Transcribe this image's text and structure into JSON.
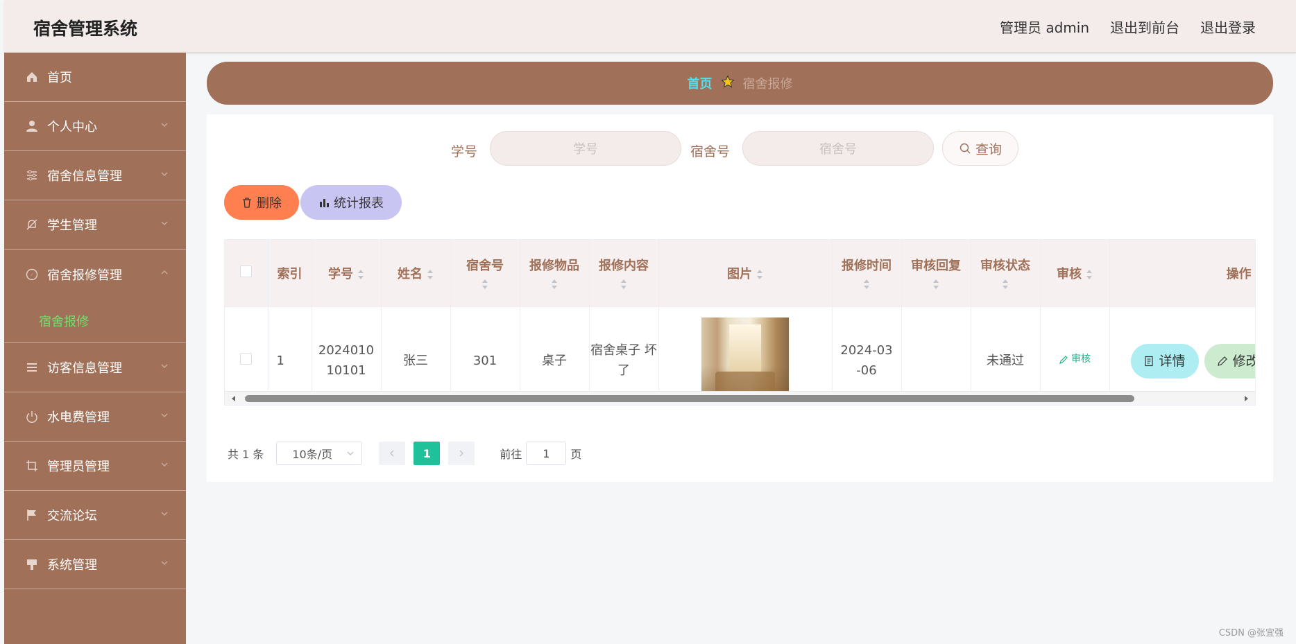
{
  "header": {
    "title": "宿舍管理系统",
    "admin_label": "管理员 admin",
    "front_label": "退出到前台",
    "logout_label": "退出登录"
  },
  "sidebar": {
    "items": [
      {
        "label": "首页",
        "icon": "home-icon"
      },
      {
        "label": "个人中心",
        "icon": "user-icon"
      },
      {
        "label": "宿舍信息管理",
        "icon": "sliders-icon"
      },
      {
        "label": "学生管理",
        "icon": "bell-off-icon"
      },
      {
        "label": "宿舍报修管理",
        "icon": "compass-icon",
        "open": true,
        "sub": [
          "宿舍报修"
        ]
      },
      {
        "label": "访客信息管理",
        "icon": "menu-icon"
      },
      {
        "label": "水电费管理",
        "icon": "power-icon"
      },
      {
        "label": "管理员管理",
        "icon": "crop-icon"
      },
      {
        "label": "交流论坛",
        "icon": "flag-icon"
      },
      {
        "label": "系统管理",
        "icon": "brush-icon"
      }
    ]
  },
  "breadcrumb": {
    "home": "首页",
    "current": "宿舍报修"
  },
  "search": {
    "student_no_label": "学号",
    "student_no_placeholder": "学号",
    "dorm_no_label": "宿舍号",
    "dorm_no_placeholder": "宿舍号",
    "query_label": "查询"
  },
  "actions": {
    "delete_label": "删除",
    "report_label": "统计报表"
  },
  "table": {
    "columns": [
      "索引",
      "学号",
      "姓名",
      "宿舍号",
      "报修物品",
      "报修内容",
      "图片",
      "报修时间",
      "审核回复",
      "审核状态",
      "审核",
      "操作"
    ],
    "rows": [
      {
        "index": "1",
        "student_no": "2024010 10101",
        "name": "张三",
        "dorm_no": "301",
        "item": "桌子",
        "content": "宿舍桌子 坏了",
        "time": "2024-03 -06",
        "reply": "",
        "status": "未通过",
        "audit_label": "审核",
        "detail_label": "详情",
        "edit_label": "修改"
      }
    ]
  },
  "pagination": {
    "total_text": "共 1 条",
    "page_size": "10条/页",
    "current_page": "1",
    "goto_label": "前往",
    "goto_value": "1",
    "page_suffix": "页"
  },
  "watermark": "CSDN @张宜强",
  "colors": {
    "brand": "#a07058",
    "header_bg": "#f4eceb",
    "active_sub": "#6ee06a",
    "breadcrumb_home": "#4fe0f0",
    "delete_btn": "#ff7f50",
    "report_btn": "#c9c5f2",
    "detail_btn": "#aeeef2",
    "edit_btn": "#cdebcf",
    "page_active": "#1fc19a"
  }
}
